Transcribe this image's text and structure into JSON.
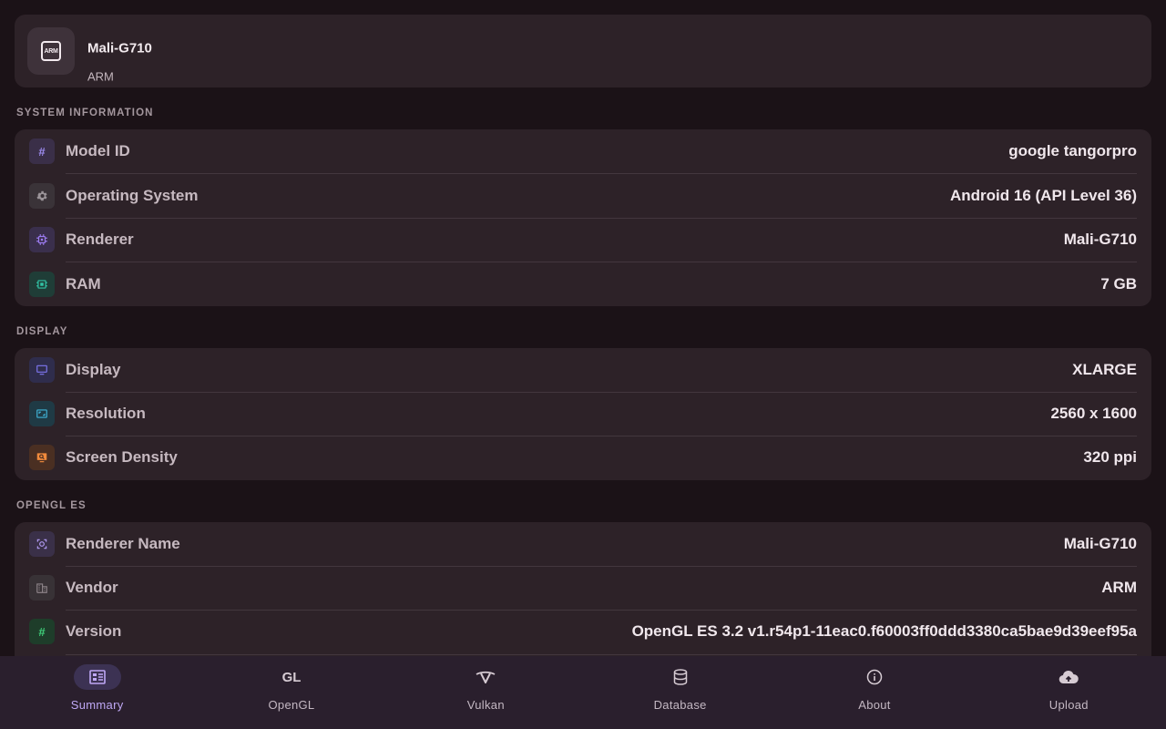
{
  "header": {
    "title": "Mali-G710",
    "subtitle": "ARM",
    "chip_icon_text": "ARM"
  },
  "sections": {
    "system": {
      "label": "SYSTEM INFORMATION",
      "rows": [
        {
          "label": "Model ID",
          "value": "google  tangorpro",
          "icon": "hash-icon",
          "color": "#9d8cf0"
        },
        {
          "label": "Operating System",
          "value": "Android 16 (API Level 36)",
          "icon": "gear-icon",
          "color": "#9b9499"
        },
        {
          "label": "Renderer",
          "value": "Mali-G710",
          "icon": "chip-icon",
          "color": "#9d7cf2"
        },
        {
          "label": "RAM",
          "value": "7 GB",
          "icon": "memory-icon",
          "color": "#32c3a6"
        }
      ]
    },
    "display": {
      "label": "DISPLAY",
      "rows": [
        {
          "label": "Display",
          "value": "XLARGE",
          "icon": "monitor-icon",
          "color": "#7e76f0"
        },
        {
          "label": "Resolution",
          "value": "2560 x 1600",
          "icon": "aspect-ratio-icon",
          "color": "#3fb3d6"
        },
        {
          "label": "Screen Density",
          "value": "320 ppi",
          "icon": "density-icon",
          "color": "#f08a3c"
        }
      ]
    },
    "opengl": {
      "label": "OPENGL ES",
      "rows": [
        {
          "label": "Renderer Name",
          "value": "Mali-G710",
          "icon": "renderer-icon",
          "color": "#b49cf5"
        },
        {
          "label": "Vendor",
          "value": "ARM",
          "icon": "building-icon",
          "color": "#8c8388"
        },
        {
          "label": "Version",
          "value": "OpenGL ES 3.2 v1.r54p1-11eac0.f60003ff0ddd3380ca5bae9d39eef95a",
          "icon": "hash-icon",
          "color": "#3fcf7a"
        }
      ]
    }
  },
  "nav": {
    "items": [
      {
        "label": "Summary",
        "icon": "summary-icon",
        "active": true
      },
      {
        "label": "OpenGL",
        "icon": "gl-icon",
        "icon_text": "GL"
      },
      {
        "label": "Vulkan",
        "icon": "vulkan-icon"
      },
      {
        "label": "Database",
        "icon": "database-icon"
      },
      {
        "label": "About",
        "icon": "info-icon"
      },
      {
        "label": "Upload",
        "icon": "cloud-upload-icon"
      }
    ]
  },
  "colors": {
    "background": "#1b1217",
    "card": "#2d2228",
    "nav_bar": "#2a1f2d",
    "nav_active": "#bfa8f5"
  }
}
